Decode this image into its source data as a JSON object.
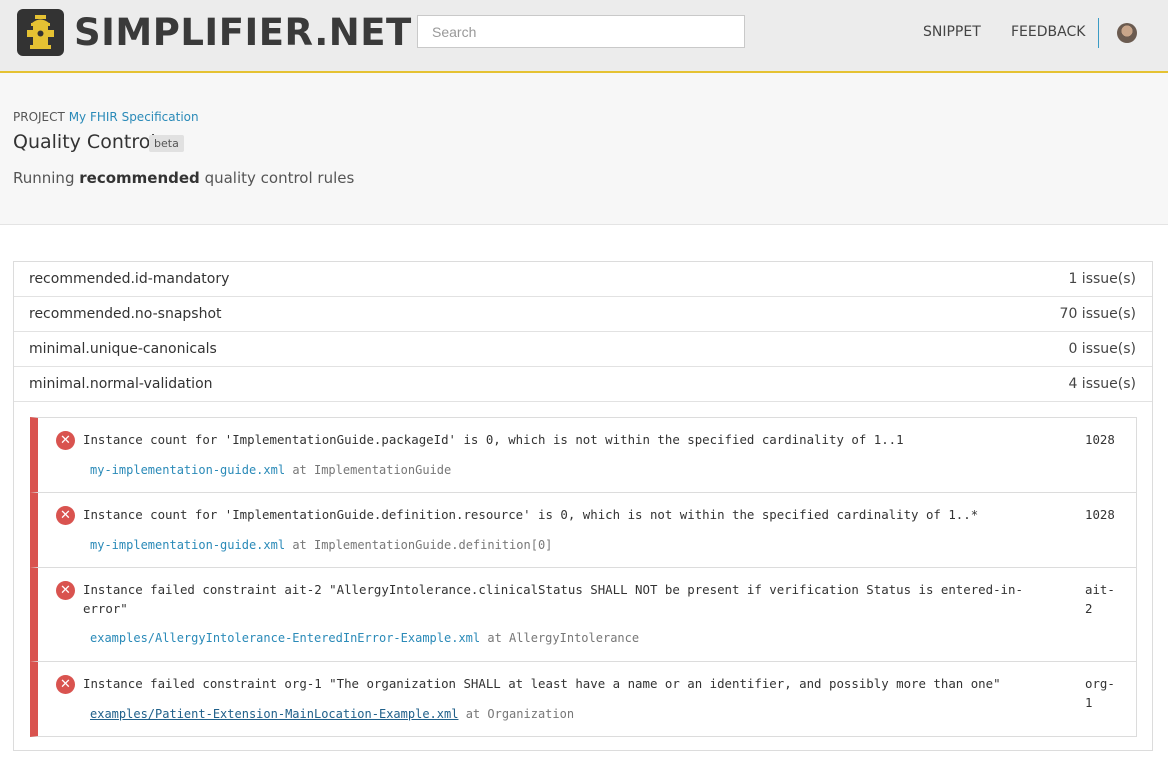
{
  "header": {
    "brand": "SIMPLIFIER.NET",
    "search_placeholder": "Search",
    "nav": [
      "SNIPPET",
      "FEEDBACK"
    ]
  },
  "project": {
    "label": "PROJECT",
    "name": "My FHIR Specification",
    "title": "Quality Control",
    "badge": "beta",
    "subtitle_pre": "Running",
    "subtitle_bold": "recommended",
    "subtitle_post": "quality control rules"
  },
  "rules": [
    {
      "name": "recommended.id-mandatory",
      "count": "1 issue(s)"
    },
    {
      "name": "recommended.no-snapshot",
      "count": "70 issue(s)"
    },
    {
      "name": "minimal.unique-canonicals",
      "count": "0 issue(s)"
    },
    {
      "name": "minimal.normal-validation",
      "count": "4 issue(s)"
    }
  ],
  "issues": [
    {
      "message": "Instance count for 'ImplementationGuide.packageId' is 0, which is not within the specified cardinality of 1..1",
      "code": "1028",
      "file": "my-implementation-guide.xml",
      "at": "at ImplementationGuide"
    },
    {
      "message": "Instance count for 'ImplementationGuide.definition.resource' is 0, which is not within the specified cardinality of 1..*",
      "code": "1028",
      "file": "my-implementation-guide.xml",
      "at": "at ImplementationGuide.definition[0]"
    },
    {
      "message": "Instance failed constraint ait-2 \"AllergyIntolerance.clinicalStatus SHALL NOT be present if verification Status is entered-in-error\"",
      "code": "ait-2",
      "file": "examples/AllergyIntolerance-EnteredInError-Example.xml",
      "at": "at AllergyIntolerance"
    },
    {
      "message": "Instance failed constraint org-1 \"The organization SHALL at least have a name or an identifier, and possibly more than one\"",
      "code": "org-1",
      "file": "examples/Patient-Extension-MainLocation-Example.xml",
      "at": "at Organization"
    }
  ],
  "colors": {
    "accent": "#e5c233",
    "error": "#d9534f",
    "link": "#2a8ab8"
  }
}
